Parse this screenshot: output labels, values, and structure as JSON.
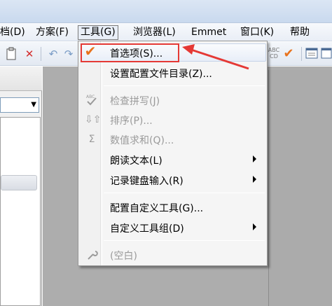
{
  "menubar": {
    "items": [
      {
        "label": "档(D)"
      },
      {
        "label": "方案(F)"
      },
      {
        "label": "工具(G)"
      },
      {
        "label": "浏览器(L)"
      },
      {
        "label": "Emmet"
      },
      {
        "label": "窗口(K)"
      },
      {
        "label": "帮助"
      }
    ],
    "active_index": 2
  },
  "tools_menu": {
    "items": [
      {
        "label": "首选项(S)...",
        "icon": "checkmark-icon",
        "enabled": true,
        "submenu": false
      },
      {
        "label": "设置配置文件目录(Z)...",
        "icon": "",
        "enabled": true,
        "submenu": false
      },
      {
        "label": "检查拼写(J)",
        "icon": "spell-check-icon",
        "enabled": false,
        "submenu": false
      },
      {
        "label": "排序(P)...",
        "icon": "sort-icon",
        "enabled": false,
        "submenu": false
      },
      {
        "label": "数值求和(Q)...",
        "icon": "sigma-icon",
        "enabled": false,
        "submenu": false
      },
      {
        "label": "朗读文本(L)",
        "icon": "",
        "enabled": true,
        "submenu": true
      },
      {
        "label": "记录键盘输入(R)",
        "icon": "",
        "enabled": true,
        "submenu": true
      },
      {
        "label": "配置自定义工具(G)...",
        "icon": "",
        "enabled": true,
        "submenu": false
      },
      {
        "label": "自定义工具组(D)",
        "icon": "",
        "enabled": true,
        "submenu": true
      },
      {
        "label": "(空白)",
        "icon": "wrench-icon",
        "enabled": false,
        "submenu": false
      }
    ]
  },
  "colors": {
    "accent_check": "#e8731d",
    "annotation_red": "#e53935",
    "editor_bg": "#adadad"
  }
}
